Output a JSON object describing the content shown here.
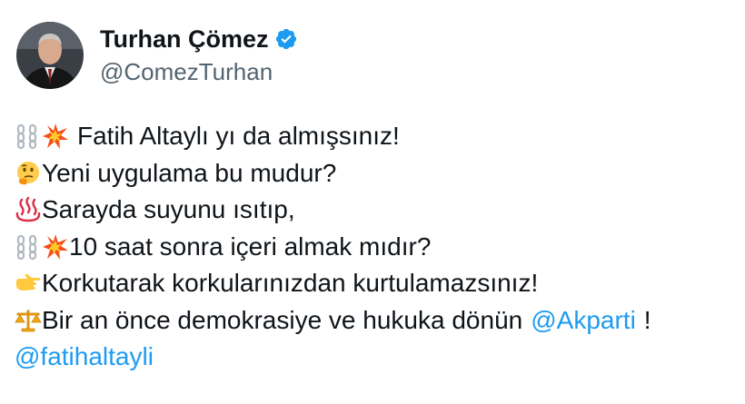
{
  "user": {
    "display_name": "Turhan Çömez",
    "handle": "@ComezTurhan",
    "verified": true,
    "avatar_icon": "profile-photo"
  },
  "tweet": {
    "lines": [
      {
        "emojis": [
          "chains-icon",
          "collision-icon"
        ],
        "text": "Fatih Altaylı yı da almışsınız!"
      },
      {
        "emojis": [
          "thinking-face-icon"
        ],
        "text": "Yeni uygulama bu mudur?"
      },
      {
        "emojis": [
          "hot-springs-icon"
        ],
        "text": "Sarayda suyunu ısıtıp,"
      },
      {
        "emojis": [
          "chains-icon",
          "collision-icon"
        ],
        "text": "10 saat sonra içeri almak mıdır?"
      },
      {
        "emojis": [
          "pointing-right-icon"
        ],
        "text": "Korkutarak korkularınızdan kurtulamazsınız!"
      },
      {
        "emojis": [
          "balance-scale-icon"
        ],
        "text": "Bir an önce demokrasiye ve hukuka dönün",
        "mention": "@Akparti",
        "suffix": "!"
      },
      {
        "emojis": [],
        "mention": "@fatihaltayli"
      }
    ]
  },
  "colors": {
    "text": "#0f1419",
    "secondary": "#536471",
    "link": "#1d9bf0",
    "verified": "#1d9bf0"
  }
}
